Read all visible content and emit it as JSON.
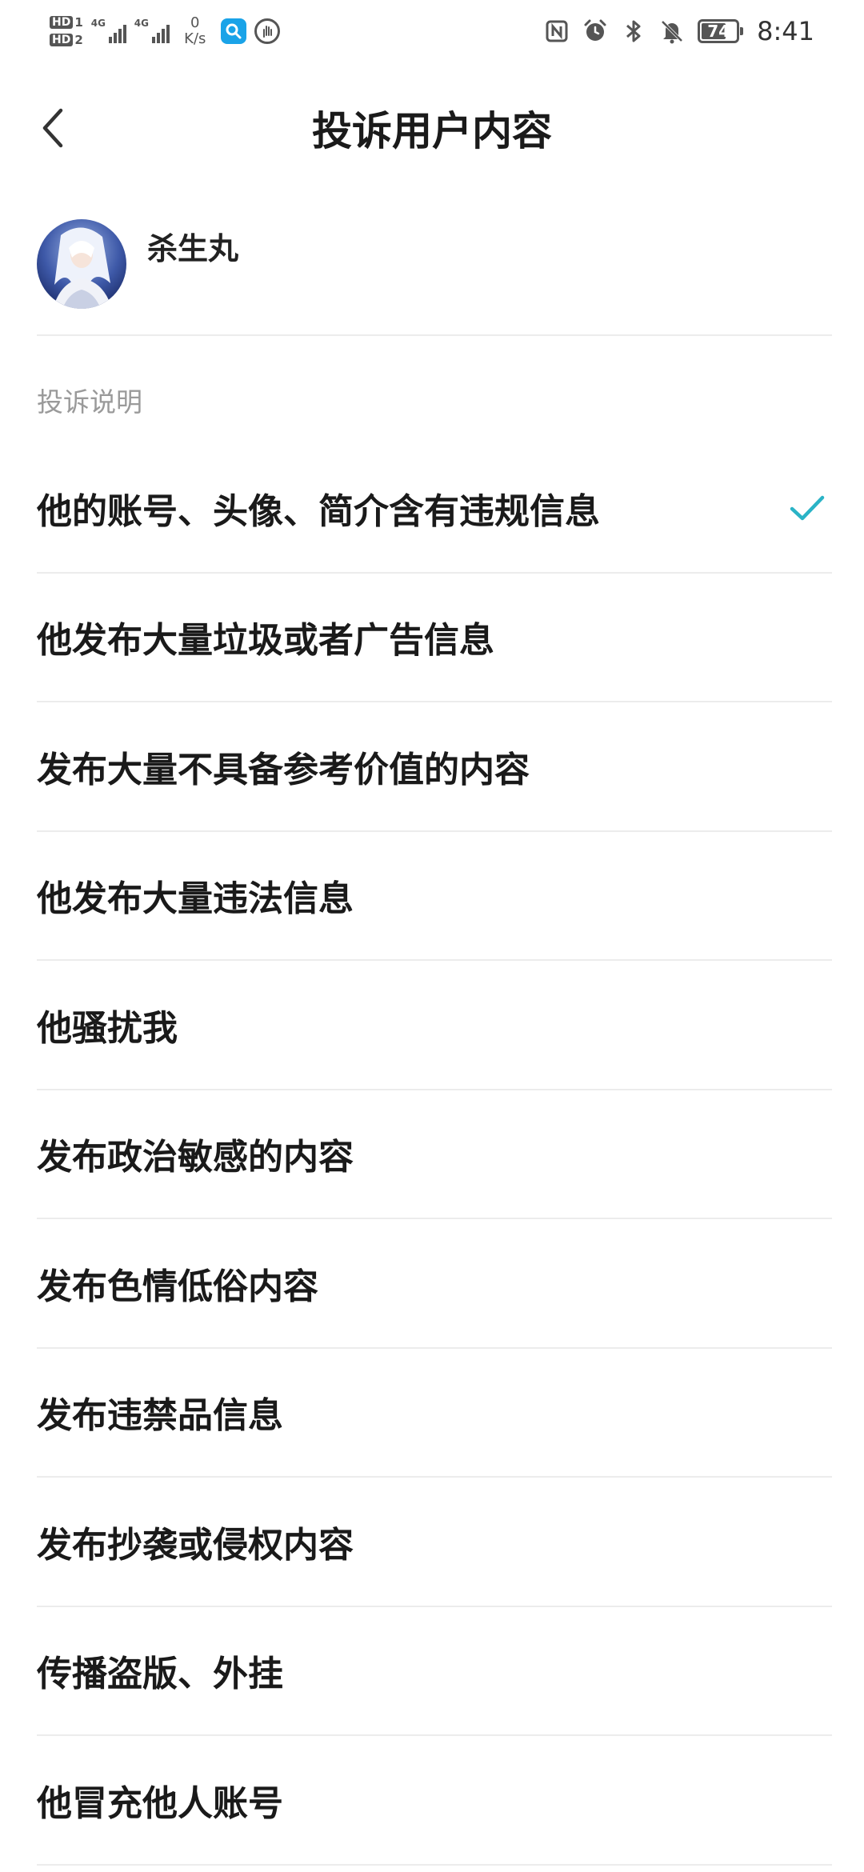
{
  "status_bar": {
    "sim1_label": "HD",
    "sim1_number": "1",
    "sim2_label": "HD",
    "sim2_number": "2",
    "network1": "4G",
    "network2": "4G",
    "speed_value": "0",
    "speed_unit": "K/s",
    "battery_level": "74",
    "time": "8:41",
    "icons": [
      "nfc-icon",
      "alarm-icon",
      "bluetooth-icon",
      "mute-bell-icon"
    ]
  },
  "header": {
    "title": "投诉用户内容"
  },
  "user": {
    "name": "杀生丸"
  },
  "section_label": "投诉说明",
  "accent_color": "#2ab3c6",
  "options": [
    {
      "label": "他的账号、头像、简介含有违规信息",
      "selected": true
    },
    {
      "label": "他发布大量垃圾或者广告信息",
      "selected": false
    },
    {
      "label": "发布大量不具备参考价值的内容",
      "selected": false
    },
    {
      "label": "他发布大量违法信息",
      "selected": false
    },
    {
      "label": "他骚扰我",
      "selected": false
    },
    {
      "label": "发布政治敏感的内容",
      "selected": false
    },
    {
      "label": "发布色情低俗内容",
      "selected": false
    },
    {
      "label": "发布违禁品信息",
      "selected": false
    },
    {
      "label": "发布抄袭或侵权内容",
      "selected": false
    },
    {
      "label": "传播盗版、外挂",
      "selected": false
    },
    {
      "label": "他冒充他人账号",
      "selected": false
    }
  ]
}
